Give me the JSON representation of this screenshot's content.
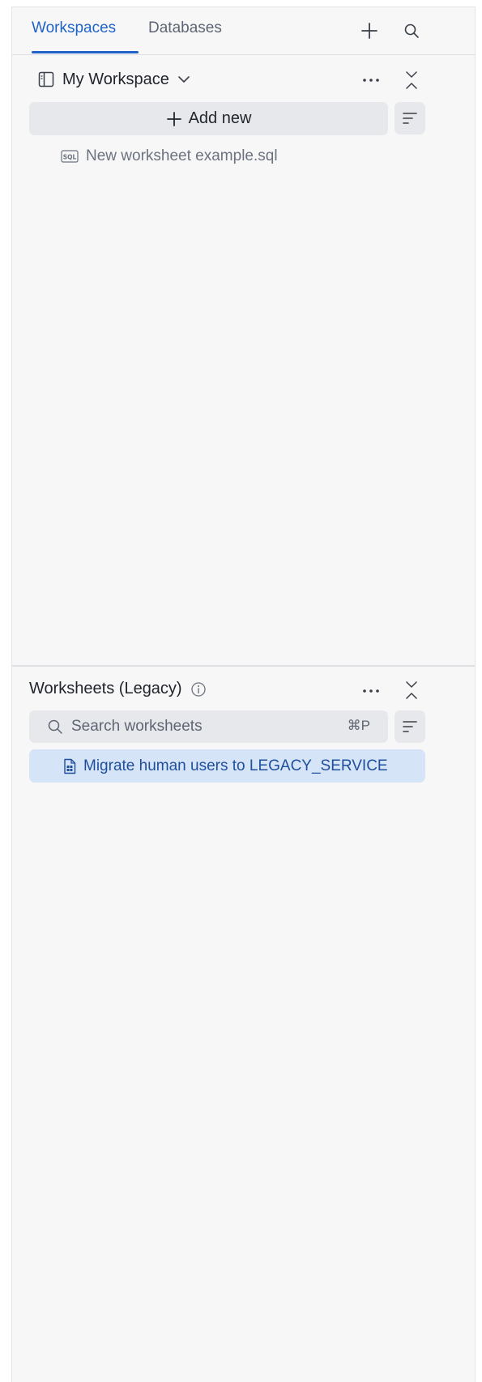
{
  "tabs": [
    {
      "label": "Workspaces",
      "active": true
    },
    {
      "label": "Databases",
      "active": false
    }
  ],
  "header_icons": {
    "add": "plus-icon",
    "search": "search-icon"
  },
  "workspace": {
    "title": "My Workspace",
    "add_new_label": "Add new",
    "files": [
      {
        "name": "New worksheet example.sql",
        "icon": "sql-file-icon"
      }
    ]
  },
  "legacy": {
    "title": "Worksheets (Legacy)",
    "search_placeholder": "Search worksheets",
    "shortcut": "⌘P",
    "items": [
      {
        "name": "Migrate human users to LEGACY_SERVICE",
        "icon": "worksheet-file-icon",
        "selected": true
      }
    ]
  },
  "colors": {
    "accent": "#1f63c6",
    "panel_bg": "#f7f7f8",
    "control_bg": "#e7e8eb",
    "selected_bg": "#d6e4f7"
  }
}
